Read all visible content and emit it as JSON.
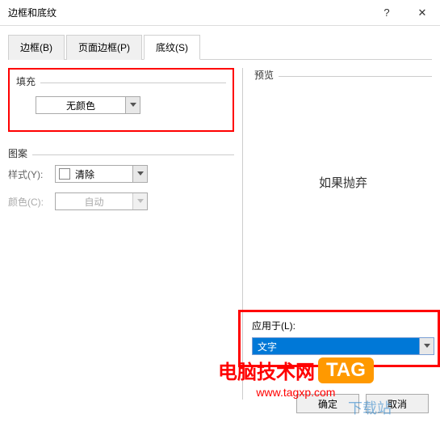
{
  "titlebar": {
    "title": "边框和底纹",
    "help": "?",
    "close": "✕"
  },
  "tabs": {
    "border": "边框(B)",
    "page_border": "页面边框(P)",
    "shading": "底纹(S)"
  },
  "fill": {
    "label": "填充",
    "value": "无颜色"
  },
  "pattern": {
    "label": "图案",
    "style_label": "样式(Y):",
    "style_value": "清除",
    "color_label": "颜色(C):",
    "color_value": "自动"
  },
  "preview": {
    "label": "预览",
    "text": "如果抛弃"
  },
  "apply": {
    "label": "应用于(L):",
    "value": "文字"
  },
  "buttons": {
    "ok": "确定",
    "cancel": "取消"
  },
  "watermark": {
    "text": "电脑技术网",
    "tag": "TAG",
    "url": "www.tagxp.com",
    "dl": "下载站"
  }
}
